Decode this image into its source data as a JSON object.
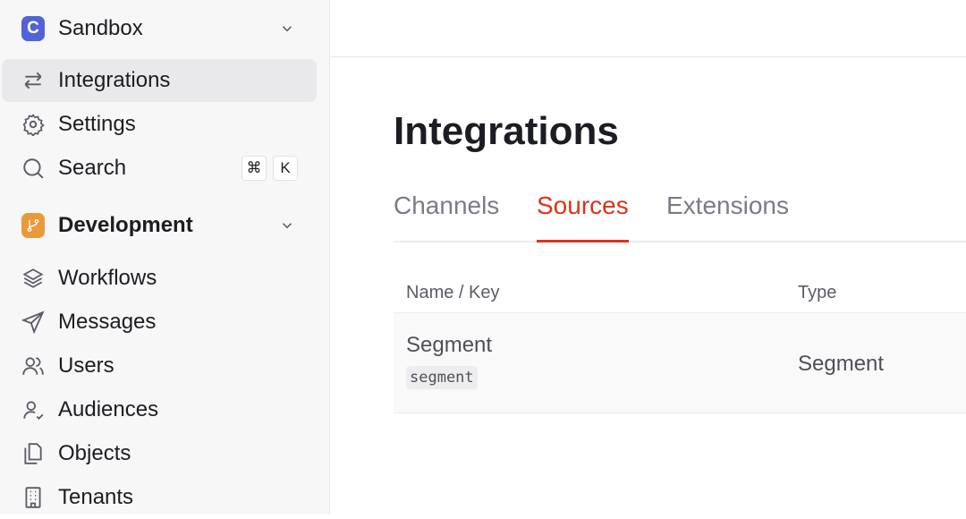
{
  "sidebar": {
    "workspace": {
      "badge": "C",
      "label": "Sandbox",
      "color": "#5163d6"
    },
    "top_items": [
      {
        "label": "Integrations",
        "icon": "arrows-exchange-icon",
        "active": true
      },
      {
        "label": "Settings",
        "icon": "gear-icon"
      },
      {
        "label": "Search",
        "icon": "search-icon",
        "shortcut": [
          "⌘",
          "K"
        ]
      }
    ],
    "environment": {
      "label": "Development",
      "icon": "git-branch-icon",
      "color": "#e99a3a"
    },
    "env_items": [
      {
        "label": "Workflows",
        "icon": "layers-icon"
      },
      {
        "label": "Messages",
        "icon": "send-icon"
      },
      {
        "label": "Users",
        "icon": "users-icon"
      },
      {
        "label": "Audiences",
        "icon": "user-check-icon"
      },
      {
        "label": "Objects",
        "icon": "copy-icon"
      },
      {
        "label": "Tenants",
        "icon": "building-icon"
      }
    ]
  },
  "main": {
    "title": "Integrations",
    "tabs": [
      {
        "label": "Channels"
      },
      {
        "label": "Sources",
        "active": true
      },
      {
        "label": "Extensions"
      }
    ],
    "accent": "#d8341a",
    "table": {
      "columns": [
        "Name / Key",
        "Type"
      ],
      "rows": [
        {
          "name": "Segment",
          "key": "segment",
          "type": "Segment"
        }
      ]
    }
  }
}
